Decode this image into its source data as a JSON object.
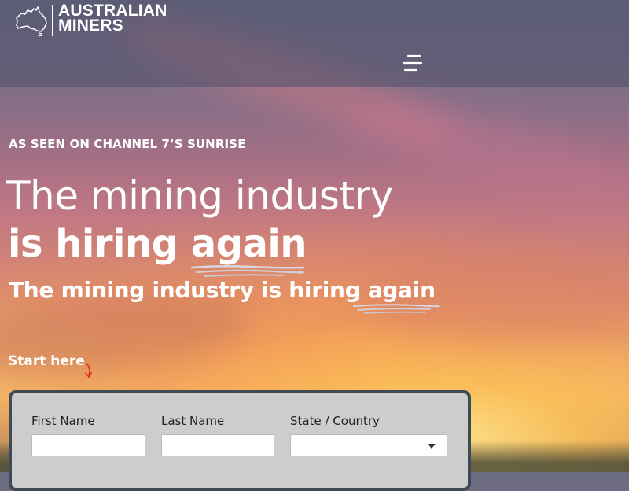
{
  "brand": {
    "line1": "AUSTRALIAN",
    "line2": "MINERS",
    "logo_icon": "australia-map-icon"
  },
  "header": {
    "menu_icon": "hamburger-menu-icon"
  },
  "hero": {
    "badge": "AS SEEN ON CHANNEL 7’S SUNRISE",
    "headline_line1": "The mining industry",
    "headline_line2": "is hiring again",
    "subheadline": "The mining industry is hiring again",
    "cta_label": "Start here",
    "cta_icon": "curved-arrow-down-icon"
  },
  "form": {
    "first_name": {
      "label": "First Name",
      "value": ""
    },
    "last_name": {
      "label": "Last Name",
      "value": ""
    },
    "state": {
      "label": "State / Country",
      "selected": ""
    }
  },
  "colors": {
    "header_overlay": "#50506C",
    "form_background": "#CDCDCD",
    "form_border": "#3F4A57",
    "text": "#FFFFFF",
    "arrow": "#D93025"
  }
}
